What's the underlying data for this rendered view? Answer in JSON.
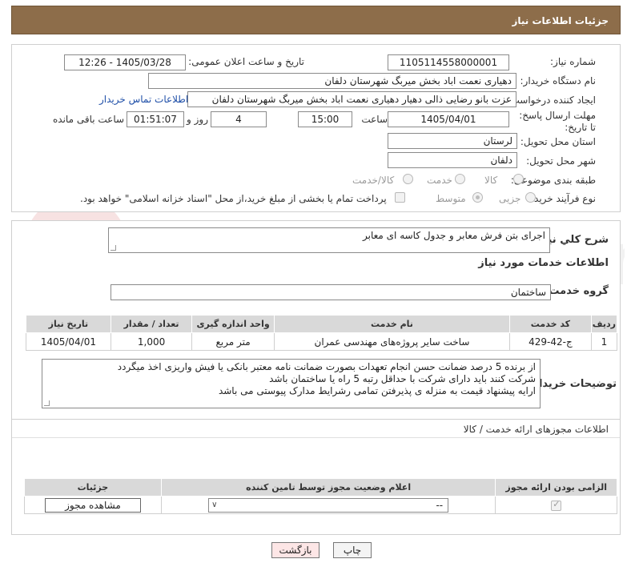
{
  "header": {
    "title": "جزئیات اطلاعات نیاز"
  },
  "form": {
    "need_number_label": "شماره نیاز:",
    "need_number": "1105114558000001",
    "announce_label": "تاریخ و ساعت اعلان عمومی:",
    "announce_value": "1405/03/28 - 12:26",
    "buyer_org_label": "نام دستگاه خریدار:",
    "buyer_org": "دهیاری نعمت اباد بخش میربگ شهرستان دلفان",
    "creator_label": "ایجاد کننده درخواست:",
    "creator": "عزت بانو رضایی ذالی دهیار دهیاری نعمت اباد بخش میربگ شهرستان دلفان",
    "contact_link": "اطلاعات تماس خریدار",
    "deadline_label": "مهلت ارسال پاسخ: تا تاریخ:",
    "deadline_date": "1405/04/01",
    "time_label": "ساعت",
    "deadline_time": "15:00",
    "days_value": "4",
    "days_label": "روز و",
    "remaining_time": "01:51:07",
    "remaining_label": "ساعت باقی مانده",
    "province_label": "استان محل تحویل:",
    "province": "لرستان",
    "city_label": "شهر محل تحویل:",
    "city": "دلفان",
    "category_label": "طبقه بندی موضوعی:",
    "category_options": {
      "goods": "کالا",
      "service": "خدمت",
      "goods_service": "کالا/خدمت"
    },
    "process_label": "نوع فرآیند خرید :",
    "process_options": {
      "partial": "جزیی",
      "medium": "متوسط"
    },
    "payment_note": "پرداخت تمام یا بخشی از مبلغ خرید،از محل \"اسناد خزانه اسلامی\" خواهد بود."
  },
  "description": {
    "label": "شرح کلي نياز:",
    "value": "اجرای بتن فرش معابر و جدول کاسه ای معابر"
  },
  "services": {
    "section_title": "اطلاعات خدمات مورد نیاز",
    "group_label": "گروه خدمت:",
    "group_value": "ساختمان",
    "columns": [
      "ردیف",
      "کد خدمت",
      "نام خدمت",
      "واحد اندازه گیری",
      "تعداد / مقدار",
      "تاریخ نیاز"
    ],
    "rows": [
      {
        "row": "1",
        "code": "ج-42-429",
        "name": "ساخت سایر پروژه‌های مهندسی عمران",
        "unit": "متر مربع",
        "qty": "1,000",
        "date": "1405/04/01"
      }
    ]
  },
  "buyer_notes": {
    "label": "توضیحات خریدار:",
    "lines": [
      "از برنده 5 درصد ضمانت حسن انجام تعهدات بصورت ضمانت نامه معتبر بانکی یا فیش واریزی اخذ میگردد",
      "شرکت کنند باید دارای شرکت با حداقل رتبه 5 راه یا ساختمان باشد",
      "ارایه پیشنهاد قیمت به منزله ی پذیرفتن تمامی رشرایط مدارک پیوستی می باشد"
    ]
  },
  "licenses": {
    "title": "اطلاعات مجوزهای ارائه خدمت / کالا",
    "columns": [
      "الزامی بودن ارائه مجوز",
      "اعلام وضعیت مجوز توسط تامین کننده",
      "جزئیات"
    ],
    "select_value": "--",
    "view_button": "مشاهده مجوز"
  },
  "actions": {
    "print": "چاپ",
    "back": "بازگشت"
  },
  "watermark": {
    "text": "AriaTender.neT"
  }
}
